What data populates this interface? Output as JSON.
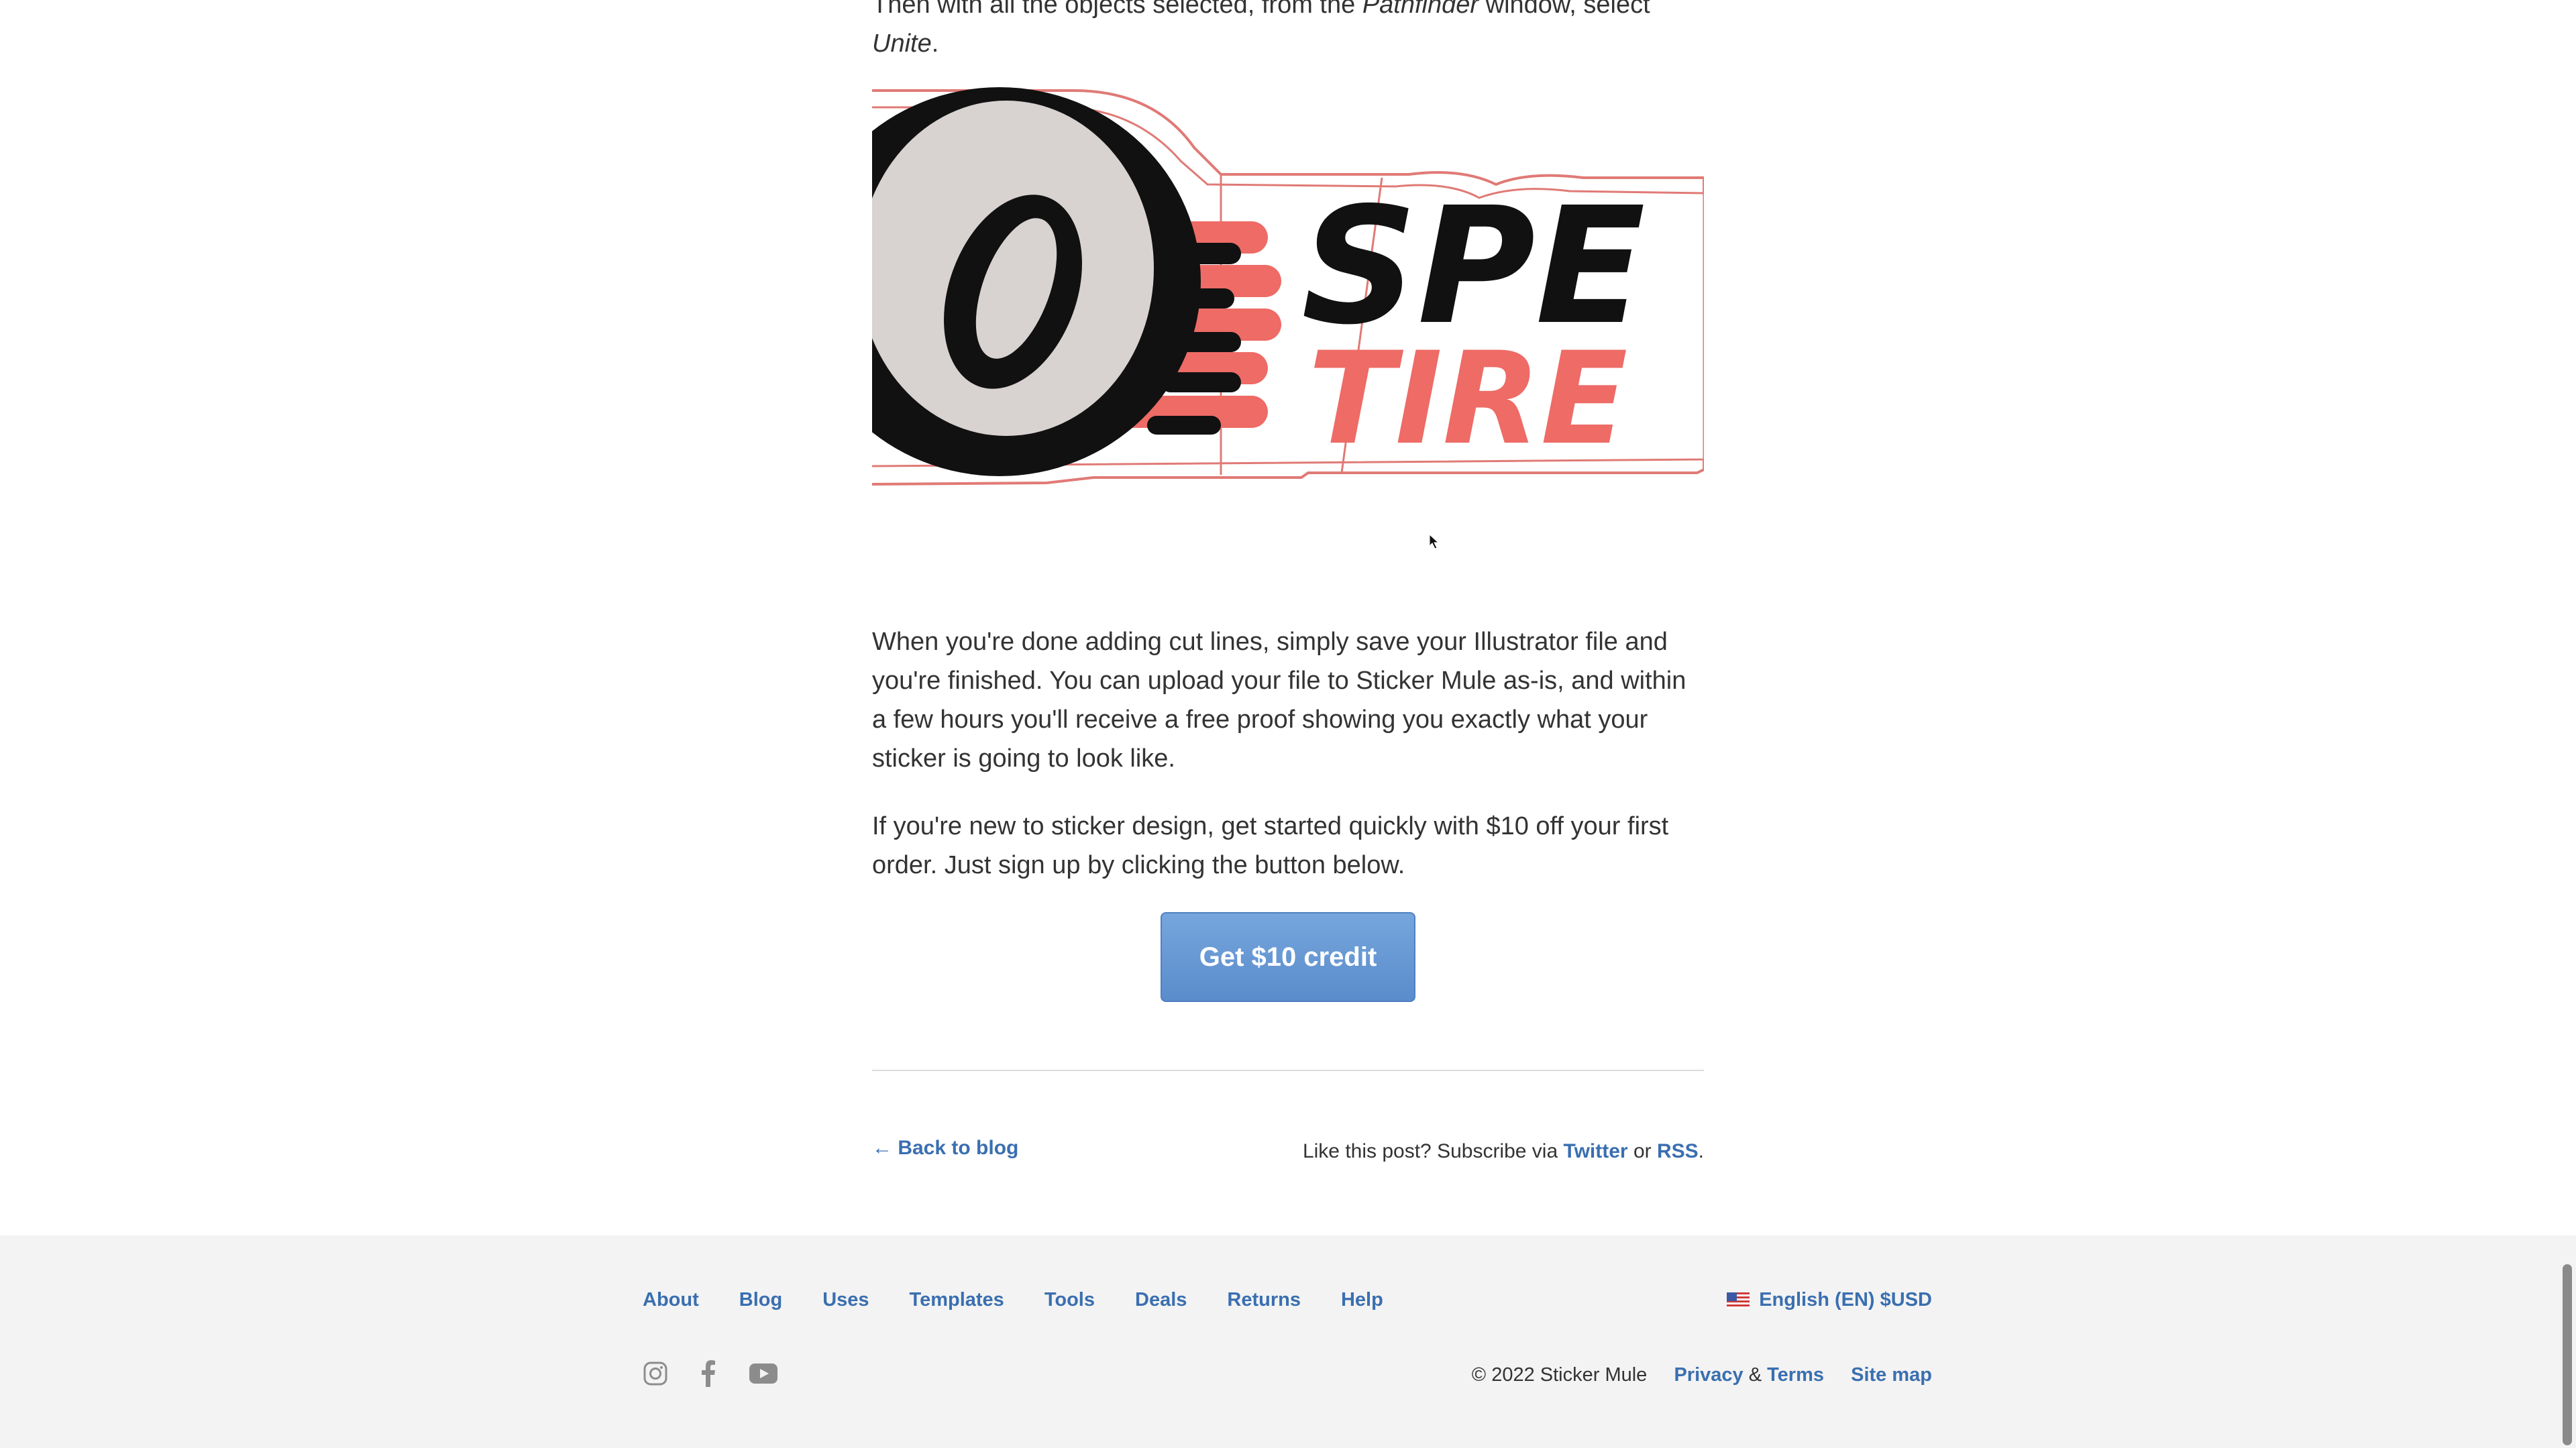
{
  "article": {
    "intro_before": "Then with all the objects selected, from the ",
    "intro_pathfinder": "Pathfinder",
    "intro_middle": " window, select ",
    "intro_unite": "Unite",
    "intro_end": ".",
    "hero_image": {
      "alt": "Speed Tire sticker with cut line",
      "text_top": "SPE",
      "text_bottom": "TIRE"
    },
    "paragraph_1": "When you're done adding cut lines, simply save your Illustrator file and you're finished. You can upload your file to Sticker Mule as-is, and within a few hours you'll receive a free proof showing you exactly what your sticker is going to look like.",
    "paragraph_2": "If you're new to sticker design, get started quickly with $10 off your first order. Just sign up by clicking the button below.",
    "cta_label": "Get $10 credit"
  },
  "post_footer": {
    "back_label": "← Back to blog",
    "subscribe_prefix": "Like this post? Subscribe via ",
    "twitter_label": "Twitter",
    "or_label": " or ",
    "rss_label": "RSS",
    "subscribe_suffix": "."
  },
  "footer": {
    "nav": [
      "About",
      "Blog",
      "Uses",
      "Templates",
      "Tools",
      "Deals",
      "Returns",
      "Help"
    ],
    "language_label": "English (EN) $USD",
    "social_icons": [
      "instagram-icon",
      "facebook-icon",
      "youtube-icon"
    ],
    "copyright": "© 2022 Sticker Mule",
    "privacy_label": "Privacy",
    "amp": " & ",
    "terms_label": "Terms",
    "sitemap_label": "Site map"
  },
  "colors": {
    "link": "#3a6fb0",
    "cta": "#6a9bd6",
    "sticker_red": "#ee6b66",
    "footer_bg": "#f3f3f3"
  }
}
